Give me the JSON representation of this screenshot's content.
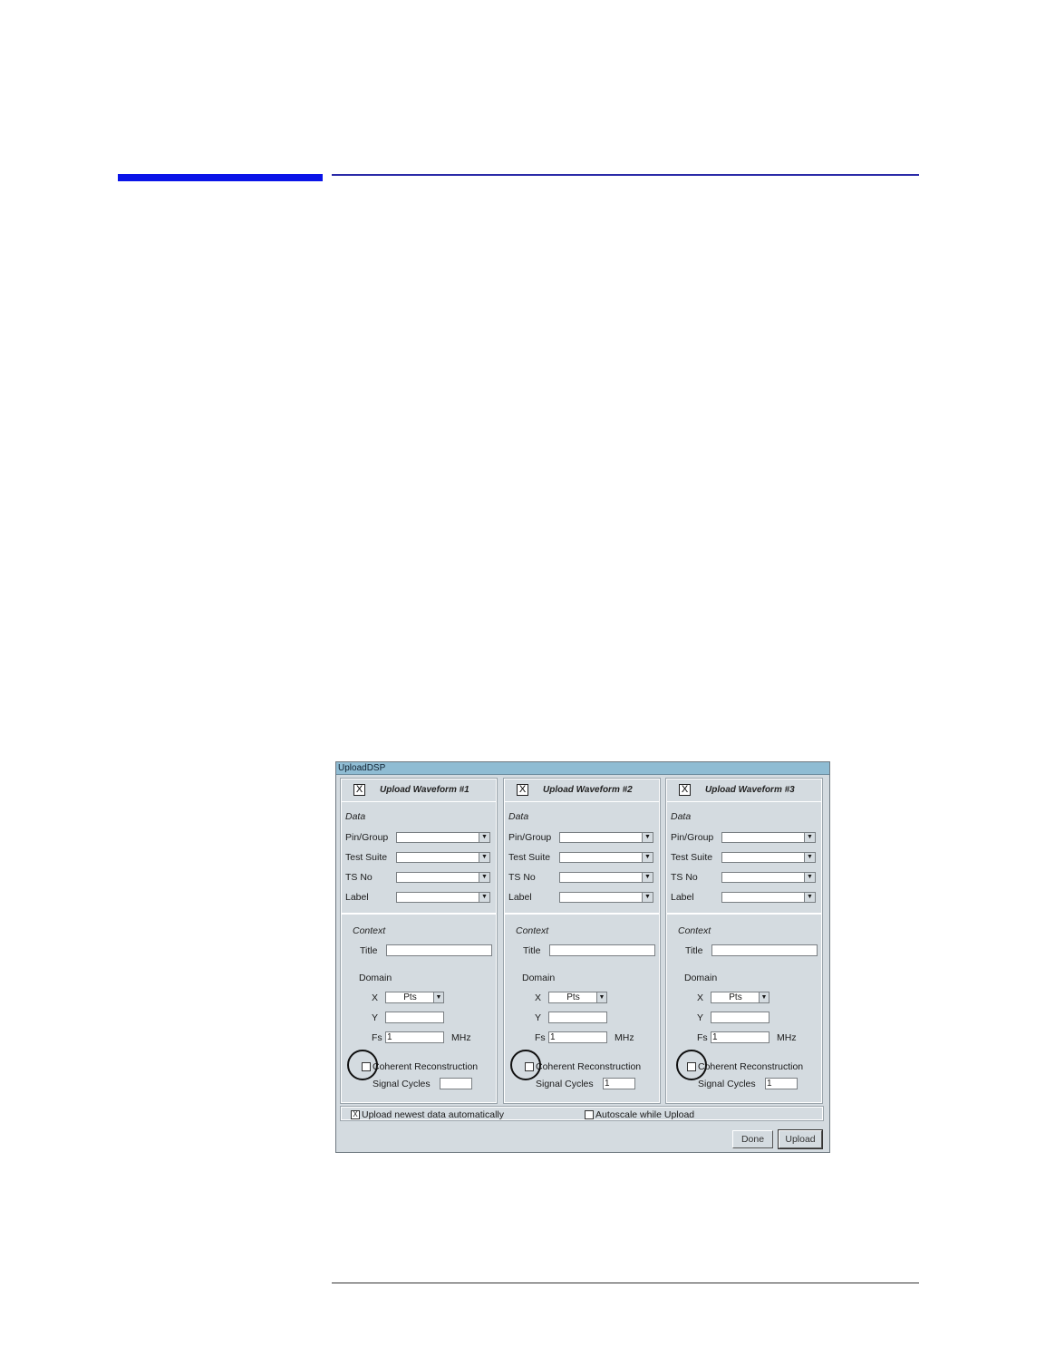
{
  "dialog": {
    "title": "UploadDSP",
    "panels": [
      {
        "enabled_mark": "X",
        "title": "Upload Waveform #1",
        "data_label": "Data",
        "fields": [
          "Pin/Group",
          "Test Suite",
          "TS No",
          "Label"
        ],
        "context_label": "Context",
        "title_label": "Title",
        "title_value": "",
        "domain_label": "Domain",
        "x_label": "X",
        "x_value": "Pts",
        "y_label": "Y",
        "fs_label": "Fs",
        "fs_value": "1",
        "fs_unit": "MHz",
        "coherent_label": "Coherent Reconstruction",
        "cycles_label": "Signal Cycles",
        "cycles_value": ""
      },
      {
        "enabled_mark": "X",
        "title": "Upload Waveform #2",
        "data_label": "Data",
        "fields": [
          "Pin/Group",
          "Test Suite",
          "TS No",
          "Label"
        ],
        "context_label": "Context",
        "title_label": "Title",
        "title_value": "",
        "domain_label": "Domain",
        "x_label": "X",
        "x_value": "Pts",
        "y_label": "Y",
        "fs_label": "Fs",
        "fs_value": "1",
        "fs_unit": "MHz",
        "coherent_label": "Coherent Reconstruction",
        "cycles_label": "Signal Cycles",
        "cycles_value": "1"
      },
      {
        "enabled_mark": "X",
        "title": "Upload Waveform #3",
        "data_label": "Data",
        "fields": [
          "Pin/Group",
          "Test Suite",
          "TS No",
          "Label"
        ],
        "context_label": "Context",
        "title_label": "Title",
        "title_value": "",
        "domain_label": "Domain",
        "x_label": "X",
        "x_value": "Pts",
        "y_label": "Y",
        "fs_label": "Fs",
        "fs_value": "1",
        "fs_unit": "MHz",
        "coherent_label": "Coherent Reconstruction",
        "cycles_label": "Signal Cycles",
        "cycles_value": "1"
      }
    ],
    "options": {
      "upload_auto_mark": "X",
      "upload_auto_label": "Upload newest data automatically",
      "autoscale_label": "Autoscale while Upload"
    },
    "buttons": {
      "done": "Done",
      "upload": "Upload"
    },
    "combo_arrow": "▼"
  },
  "colors": {
    "accent_bar": "#0a14e8",
    "titlebar": "#8fbcd3",
    "dialog_bg": "#d4dbe0"
  }
}
